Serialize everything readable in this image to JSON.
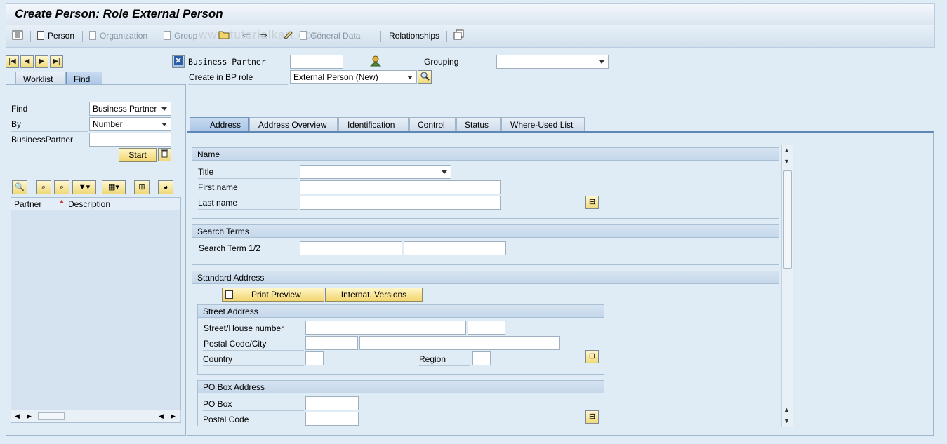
{
  "window": {
    "title": "Create Person: Role External Person"
  },
  "toolbar": {
    "person": "Person",
    "organization": "Organization",
    "group": "Group",
    "general_data": "General Data",
    "relationships": "Relationships",
    "watermark": "www.tutorialkart.com"
  },
  "left": {
    "tabs": [
      "Worklist",
      "Find"
    ],
    "find_label": "Find",
    "find_value": "Business Partner",
    "by_label": "By",
    "by_value": "Number",
    "bp_label": "BusinessPartner",
    "bp_value": "",
    "start_label": "Start",
    "columns": [
      "Partner",
      "Description"
    ]
  },
  "header": {
    "bp_label": "Business Partner",
    "bp_value": "",
    "grouping_label": "Grouping",
    "grouping_value": "",
    "role_label": "Create in BP role",
    "role_value": "External Person (New)"
  },
  "tabs": [
    "Address",
    "Address Overview",
    "Identification",
    "Control",
    "Status",
    "Where-Used List"
  ],
  "name_section": {
    "heading": "Name",
    "title_label": "Title",
    "title_value": "",
    "first_name_label": "First name",
    "first_name_value": "",
    "last_name_label": "Last name",
    "last_name_value": ""
  },
  "search_terms": {
    "heading": "Search Terms",
    "label": "Search Term 1/2",
    "value1": "",
    "value2": ""
  },
  "standard_address": {
    "heading": "Standard Address",
    "print_preview": "Print Preview",
    "internat_versions": "Internat. Versions",
    "street_heading": "Street Address",
    "street_label": "Street/House number",
    "postal_city_label": "Postal Code/City",
    "country_label": "Country",
    "region_label": "Region",
    "po_heading": "PO Box Address",
    "po_box_label": "PO Box",
    "postal_code_label": "Postal Code"
  },
  "icons": [
    "menu-icon",
    "document-icon",
    "folder-open-icon",
    "back-arrow-icon",
    "forward-arrow-icon",
    "edit-icon",
    "person-icon",
    "search-icon",
    "trash-icon",
    "expand-icon",
    "filter-icon",
    "layout-icon",
    "chart-icon"
  ]
}
